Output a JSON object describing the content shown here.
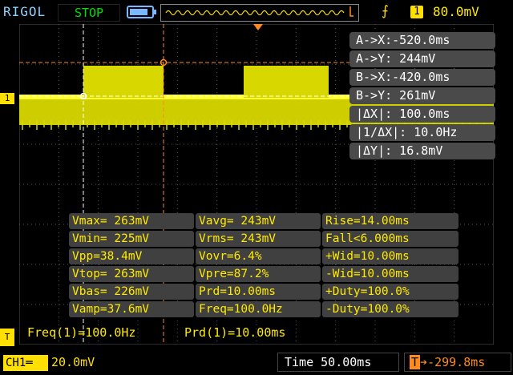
{
  "top_bar": {
    "brand": "RIGOL",
    "run_state": "STOP",
    "trigger_source": "1",
    "trigger_level": "80.0mV"
  },
  "colors": {
    "channel1": "#ffe000",
    "cursor": "#ff8a1e",
    "brand": "#8fd3ff",
    "run_state": "#00e000"
  },
  "cursors": [
    "A->X:-520.0ms",
    "A->Y: 244mV",
    "B->X:-420.0ms",
    "B->Y: 261mV",
    "|ΔX|: 100.0ms",
    "|1/ΔX|: 10.0Hz",
    "|ΔY|: 16.8mV"
  ],
  "measurements": [
    [
      "Vmax= 263mV",
      "Vavg= 243mV",
      "Rise=14.00ms"
    ],
    [
      "Vmin= 225mV",
      "Vrms= 243mV",
      "Fall<6.000ms"
    ],
    [
      "Vpp=38.4mV",
      "Vovr=6.4%",
      "+Wid=10.00ms"
    ],
    [
      "Vtop= 263mV",
      "Vpre=87.2%",
      "-Wid=10.00ms"
    ],
    [
      "Vbas= 226mV",
      "Prd=10.00ms",
      "+Duty=100.0%"
    ],
    [
      "Vamp=37.6mV",
      "Freq=100.0Hz",
      "-Duty=100.0%"
    ]
  ],
  "counters": {
    "freq": "Freq(1)=100.0Hz",
    "prd": "Prd(1)=10.00ms"
  },
  "bottom_bar": {
    "channel": "CH1",
    "channel_scale": "20.0mV",
    "timebase": "Time 50.00ms",
    "trigger_offset": "-299.8ms"
  },
  "icons": {
    "trigger_edge": "rising-edge-icon",
    "battery": "battery-icon",
    "dc_coupling": "dc-coupling-icon"
  }
}
